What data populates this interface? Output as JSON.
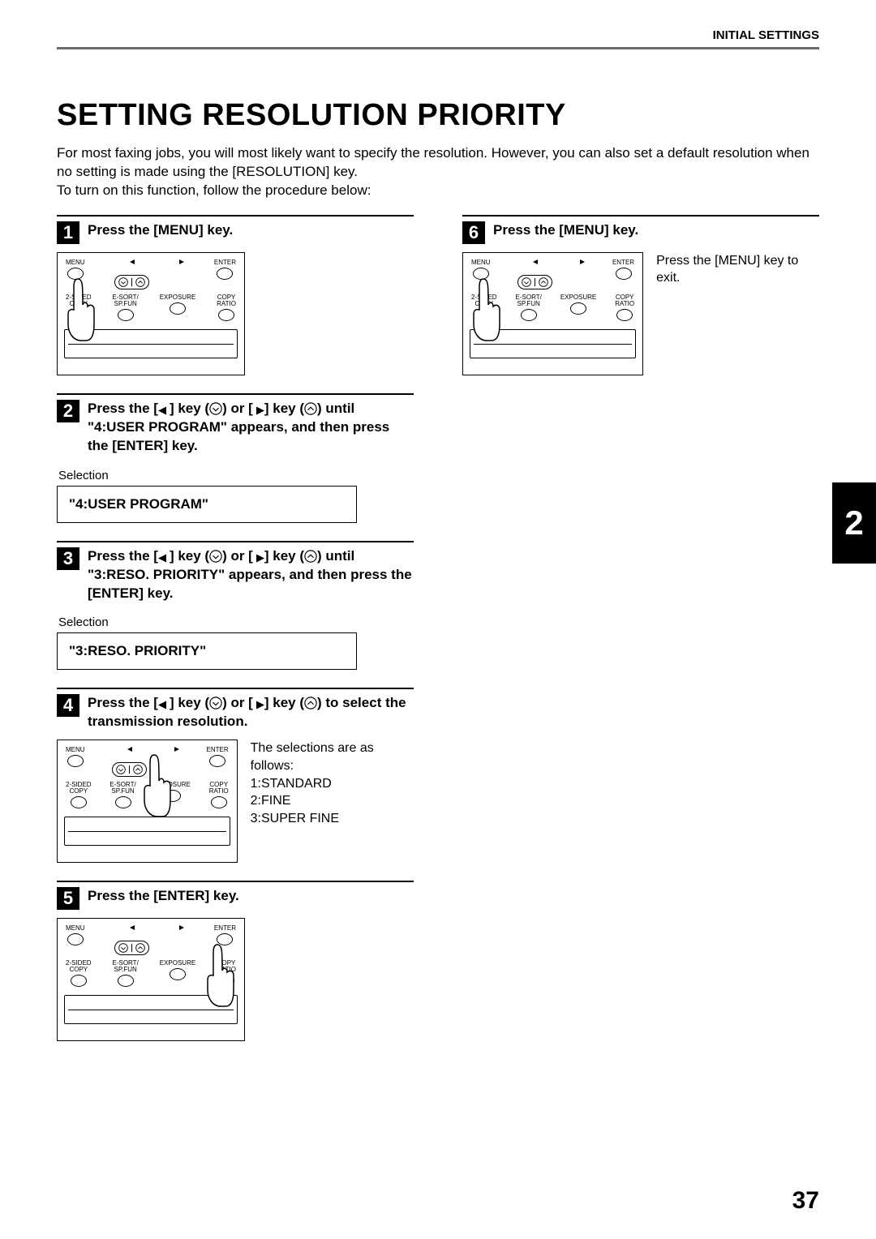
{
  "header": "INITIAL SETTINGS",
  "title": "SETTING RESOLUTION PRIORITY",
  "intro_line1": "For most faxing jobs, you will most likely want to specify the resolution. However, you can also set a default resolution when no setting is made using the [RESOLUTION] key.",
  "intro_line2": "To turn on this function, follow the procedure below:",
  "panel_labels": {
    "menu": "MENU",
    "enter": "ENTER",
    "two_sided": "2-SIDED\nCOPY",
    "esort": "E-SORT/\nSP.FUN",
    "exposure": "EXPOSURE",
    "ratio": "COPY\nRATIO"
  },
  "steps": {
    "s1": {
      "num": "1",
      "title": "Press the [MENU] key."
    },
    "s2": {
      "num": "2",
      "title_a": "Press the [",
      "title_b": "] key (",
      "title_c": ") or [",
      "title_d": "] key (",
      "title_e": ") until \"4:USER PROGRAM\" appears, and then press the [ENTER] key.",
      "selection_label": "Selection",
      "lcd": "\"4:USER PROGRAM\""
    },
    "s3": {
      "num": "3",
      "title_a": "Press the [",
      "title_b": "] key (",
      "title_c": ") or [",
      "title_d": "] key (",
      "title_e": ") until \"3:RESO. PRIORITY\" appears, and then press the [ENTER] key.",
      "selection_label": "Selection",
      "lcd": "\"3:RESO. PRIORITY\""
    },
    "s4": {
      "num": "4",
      "title_a": "Press the [",
      "title_b": "] key (",
      "title_c": ") or [",
      "title_d": "] key (",
      "title_e": ") to select the transmission resolution.",
      "sel_intro": "The selections are as follows:",
      "opt1": "1:STANDARD",
      "opt2": "2:FINE",
      "opt3": "3:SUPER FINE"
    },
    "s5": {
      "num": "5",
      "title": "Press the [ENTER] key."
    },
    "s6": {
      "num": "6",
      "title": "Press the [MENU] key.",
      "note": "Press the [MENU] key to exit."
    }
  },
  "side_tab": "2",
  "page_number": "37"
}
